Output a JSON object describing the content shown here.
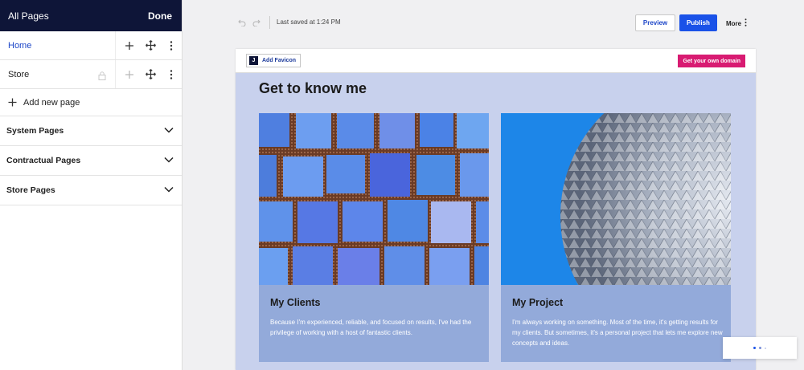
{
  "sidebar": {
    "title": "All Pages",
    "done_label": "Done",
    "pages": [
      {
        "label": "Home",
        "active": true
      },
      {
        "label": "Store",
        "active": false
      }
    ],
    "add_page_label": "Add new page",
    "groups": [
      {
        "label": "System Pages"
      },
      {
        "label": "Contractual Pages"
      },
      {
        "label": "Store Pages"
      }
    ]
  },
  "toolbar": {
    "last_saved": "Last saved at 1:24 PM",
    "preview_label": "Preview",
    "publish_label": "Publish",
    "more_label": "More"
  },
  "site": {
    "add_favicon_label": "Add Favicon",
    "favicon_letter": "J",
    "domain_label": "Get your own domain",
    "section_title": "Get to know me",
    "cards": [
      {
        "title": "My Clients",
        "body": "Because I'm experienced, reliable, and focused on results, I've had the privilege of working with a host of fantastic clients."
      },
      {
        "title": "My Project",
        "body": "I'm always working on something. Most of the time, it's getting results for my clients. But sometimes, it's a personal project that lets me explore new concepts and ideas."
      }
    ]
  },
  "colors": {
    "sidebar_header": "#0e1538",
    "accent_blue": "#1a52e8",
    "domain_pink": "#d81b72",
    "canvas_bg": "#c8d1ed",
    "card_bg": "#93aada"
  },
  "icons": {
    "add": "plus-icon",
    "move": "move-arrows-icon",
    "menu": "kebab-menu-icon",
    "lock": "lock-icon",
    "expand": "chevron-down-icon",
    "undo": "undo-icon",
    "redo": "redo-icon"
  }
}
